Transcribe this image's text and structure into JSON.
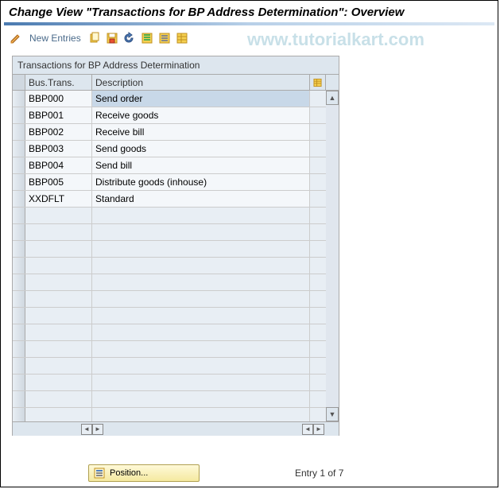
{
  "title": "Change View \"Transactions for BP Address Determination\": Overview",
  "toolbar": {
    "new_entries_label": "New Entries"
  },
  "watermark": "www.tutorialkart.com",
  "table": {
    "caption": "Transactions for BP Address Determination",
    "columns": {
      "bus_trans": "Bus.Trans.",
      "description": "Description"
    },
    "rows": [
      {
        "bus_trans": "BBP000",
        "description": "Send order",
        "selected": true
      },
      {
        "bus_trans": "BBP001",
        "description": "Receive goods",
        "selected": false
      },
      {
        "bus_trans": "BBP002",
        "description": "Receive bill",
        "selected": false
      },
      {
        "bus_trans": "BBP003",
        "description": "Send goods",
        "selected": false
      },
      {
        "bus_trans": "BBP004",
        "description": "Send bill",
        "selected": false
      },
      {
        "bus_trans": "BBP005",
        "description": "Distribute goods (inhouse)",
        "selected": false
      },
      {
        "bus_trans": "XXDFLT",
        "description": "Standard",
        "selected": false
      }
    ],
    "empty_rows": 13
  },
  "footer": {
    "position_label": "Position...",
    "entry_text": "Entry 1 of 7"
  }
}
